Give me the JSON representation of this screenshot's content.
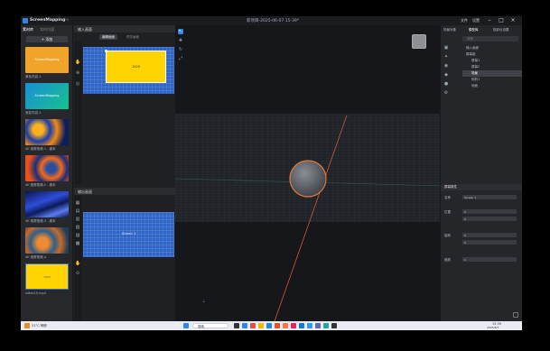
{
  "window": {
    "app_title": "ScreenMapping",
    "doc_title": "新项目-2025-06-07 15-39*",
    "menu": [
      "文件",
      "设置"
    ]
  },
  "left_panel": {
    "tabs": [
      "素材库",
      "实时内容"
    ],
    "add_button": "添加",
    "items": [
      {
        "label": "黄色内容-1",
        "thumb_text": "ScreenMapping",
        "kind": "yellow"
      },
      {
        "label": "渐变内容-1",
        "thumb_text": "ScreenMapping",
        "kind": "gradient"
      },
      {
        "label": "4K 宽屏视频-1 - 副本",
        "thumb_text": "",
        "kind": "swirl-blue"
      },
      {
        "label": "4K 宽屏视频-2 - 副本",
        "thumb_text": "",
        "kind": "swirl-red"
      },
      {
        "label": "4K 宽屏视频-3 - 副本",
        "thumb_text": "",
        "kind": "swirl-navy"
      },
      {
        "label": "4K 宽屏视频-4",
        "thumb_text": "",
        "kind": "swirl-orange"
      },
      {
        "label": "video10.mp4",
        "thumb_text": "1920",
        "kind": "yellow-small"
      }
    ]
  },
  "input_panel": {
    "title": "输入画面",
    "tabs": [
      "编辑画面",
      "预览画面"
    ],
    "content_label": "1920"
  },
  "output_panel": {
    "title": "输出画面",
    "content_label": "Screen 1"
  },
  "right_panel": {
    "tabs": [
      "场景对象",
      "模型库",
      "投影仪设置"
    ],
    "search_placeholder": "搜索",
    "tree": [
      {
        "label": "输入画面",
        "level": 0
      },
      {
        "label": "屏幕组",
        "level": 0
      },
      {
        "label": "屏幕1",
        "level": 1
      },
      {
        "label": "屏幕2",
        "level": 1
      },
      {
        "label": "场景",
        "level": 1,
        "selected": true
      },
      {
        "label": "相机1",
        "level": 1
      },
      {
        "label": "地面",
        "level": 1
      }
    ],
    "props_title": "屏幕属性",
    "props": [
      {
        "label": "名称",
        "value": "Screen 1"
      },
      {
        "label": "位置",
        "value": "0"
      },
      {
        "label": "",
        "value": "0"
      },
      {
        "label": "旋转",
        "value": "0"
      },
      {
        "label": "",
        "value": "0"
      },
      {
        "label": "缩放",
        "value": "1"
      }
    ]
  },
  "taskbar": {
    "weather": "31°C 晴朗",
    "search": "搜索",
    "time": "15:39",
    "date": "2025/6/7"
  },
  "colors": {
    "accent": "#2f86e8",
    "screen_blue": "#2f64c8",
    "highlight_orange": "#e07a3a",
    "yellow": "#ffd400"
  }
}
